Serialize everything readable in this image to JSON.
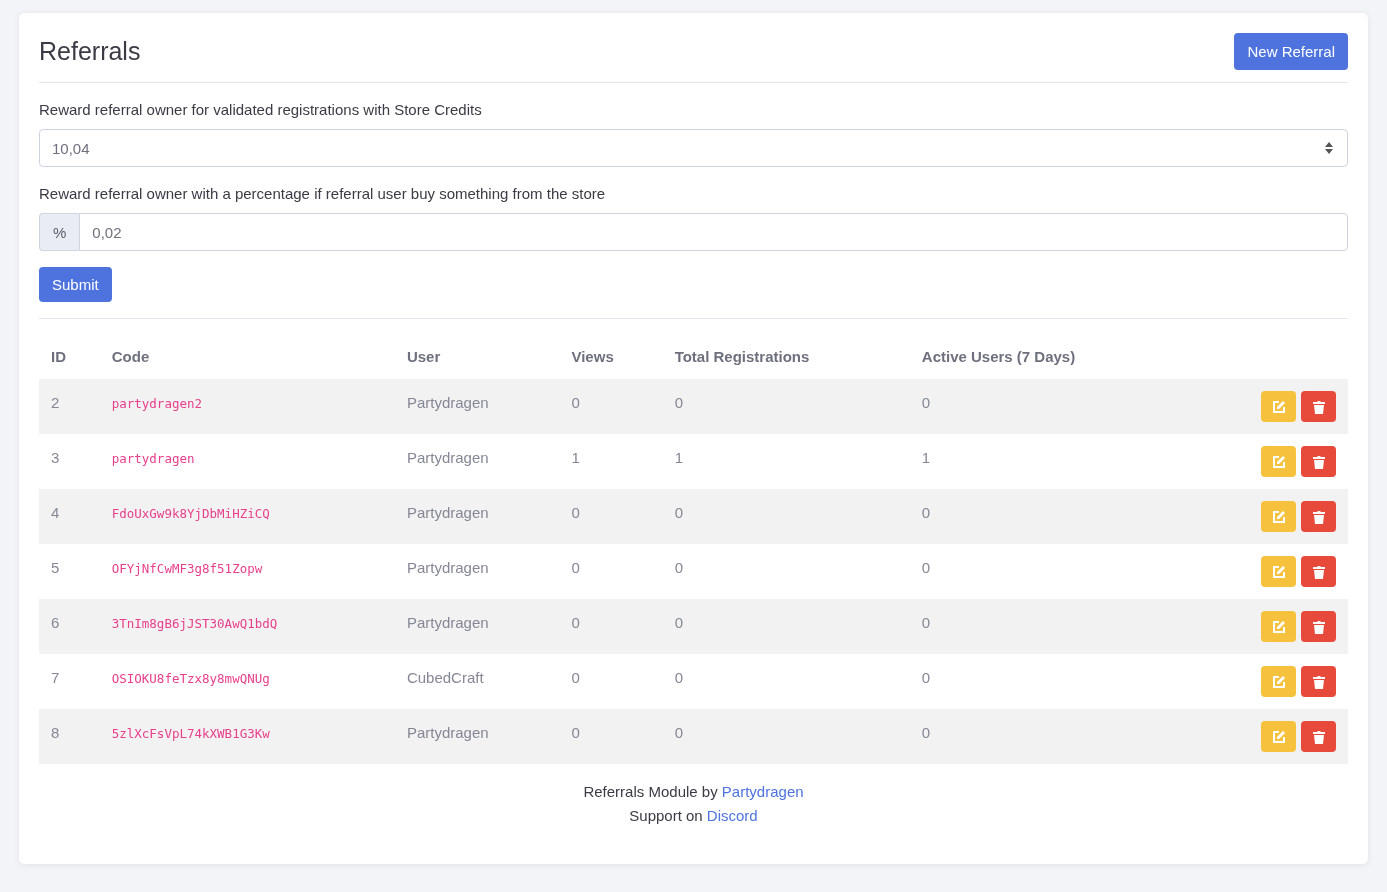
{
  "title": "Referrals",
  "new_button": "New Referral",
  "credits_field": {
    "label": "Reward referral owner for validated registrations with Store Credits",
    "value": "10,04"
  },
  "percent_field": {
    "label": "Reward referral owner with a percentage if referral user buy something from the store",
    "prefix": "%",
    "value": "0,02"
  },
  "submit": "Submit",
  "table": {
    "columns": [
      "ID",
      "Code",
      "User",
      "Views",
      "Total Registrations",
      "Active Users (7 Days)"
    ],
    "rows": [
      {
        "id": "2",
        "code": "partydragen2",
        "user": "Partydragen",
        "views": "0",
        "registrations": "0",
        "active": "0"
      },
      {
        "id": "3",
        "code": "partydragen",
        "user": "Partydragen",
        "views": "1",
        "registrations": "1",
        "active": "1"
      },
      {
        "id": "4",
        "code": "FdoUxGw9k8YjDbMiHZiCQ",
        "user": "Partydragen",
        "views": "0",
        "registrations": "0",
        "active": "0"
      },
      {
        "id": "5",
        "code": "OFYjNfCwMF3g8f51Zopw",
        "user": "Partydragen",
        "views": "0",
        "registrations": "0",
        "active": "0"
      },
      {
        "id": "6",
        "code": "3TnIm8gB6jJST30AwQ1bdQ",
        "user": "Partydragen",
        "views": "0",
        "registrations": "0",
        "active": "0"
      },
      {
        "id": "7",
        "code": "OSIOKU8feTzx8y8mwQNUg",
        "user": "CubedCraft",
        "views": "0",
        "registrations": "0",
        "active": "0"
      },
      {
        "id": "8",
        "code": "5zlXcFsVpL74kXWB1G3Kw",
        "user": "Partydragen",
        "views": "0",
        "registrations": "0",
        "active": "0"
      }
    ]
  },
  "footer": [
    {
      "text": "Referrals Module by",
      "link": "Partydragen"
    },
    {
      "text": "Support on",
      "link": "Discord"
    }
  ]
}
